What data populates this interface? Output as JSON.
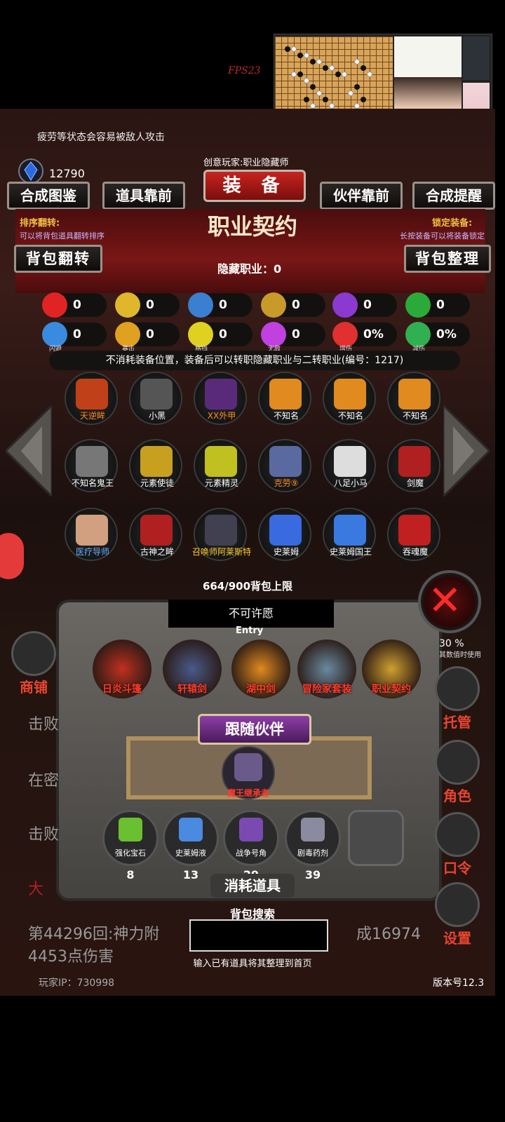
{
  "overlay": {
    "fps": "FPS23"
  },
  "hud": {
    "hint": "疲劳等状态会容易被敌人攻击",
    "currency": "12790"
  },
  "header": {
    "subtitle": "创意玩家:职业隐藏师",
    "title": "装 备",
    "tabs": [
      "合成图鉴",
      "道具靠前",
      "伙伴靠前",
      "合成提醒"
    ]
  },
  "contract": {
    "title": "职业契约",
    "left_note": {
      "title": "排序翻转:",
      "sub": "可以将背包道具翻转排序"
    },
    "right_note": {
      "title": "锁定装备:",
      "sub": "长按装备可以将装备锁定"
    },
    "left_button": "背包翻转",
    "right_button": "背包整理",
    "hidden_jobs": "隐藏职业：0"
  },
  "stats": [
    {
      "icon": "heart-icon",
      "value": "0",
      "label": "",
      "color": "#e02424"
    },
    {
      "icon": "armor-icon",
      "value": "0",
      "label": "",
      "color": "#e0b62a"
    },
    {
      "icon": "boot-icon",
      "value": "0",
      "label": "",
      "color": "#3a7fd0"
    },
    {
      "icon": "sword-icon",
      "value": "0",
      "label": "",
      "color": "#c89a2a"
    },
    {
      "icon": "lightning-icon",
      "value": "0",
      "label": "",
      "color": "#8a3ad0"
    },
    {
      "icon": "clover-icon",
      "value": "0",
      "label": "",
      "color": "#2aaa3a"
    },
    {
      "icon": "dodge-icon",
      "value": "0",
      "label": "闪避",
      "color": "#3a8ae0"
    },
    {
      "icon": "crit-icon",
      "value": "0",
      "label": "暴击",
      "color": "#e0a020"
    },
    {
      "icon": "block-icon",
      "value": "0",
      "label": "格挡",
      "color": "#e0d020"
    },
    {
      "icon": "invincible-icon",
      "value": "0",
      "label": "无敌",
      "color": "#c040e0"
    },
    {
      "icon": "damage-up-icon",
      "value": "0%",
      "label": "增伤",
      "color": "#e03030"
    },
    {
      "icon": "damage-down-icon",
      "value": "0%",
      "label": "减伤",
      "color": "#30b050"
    }
  ],
  "description": "不消耗装备位置，装备后可以转职隐藏职业与二转职业(编号：1217)",
  "jobs": [
    {
      "name": "天逆眸",
      "color": "#ff8a1a",
      "pic": "#c0401a"
    },
    {
      "name": "小黑",
      "color": "#ffffff",
      "pic": "#555"
    },
    {
      "name": "XX外甲",
      "color": "#ff8a1a",
      "pic": "#5a2a7a"
    },
    {
      "name": "不知名",
      "color": "#ffffff",
      "pic": "#e08a20"
    },
    {
      "name": "不知名",
      "color": "#ffffff",
      "pic": "#e08a20"
    },
    {
      "name": "不知名",
      "color": "#ffffff",
      "pic": "#e08a20"
    },
    {
      "name": "不知名鬼王",
      "color": "#ffffff",
      "pic": "#777"
    },
    {
      "name": "元素使徒",
      "color": "#ffffff",
      "pic": "#c8a020"
    },
    {
      "name": "元素精灵",
      "color": "#ffffff",
      "pic": "#c0c020"
    },
    {
      "name": "克劳⑨",
      "color": "#ff8a1a",
      "pic": "#5a6aa0"
    },
    {
      "name": "八足小马",
      "color": "#ffffff",
      "pic": "#ddd"
    },
    {
      "name": "剑魔",
      "color": "#ffffff",
      "pic": "#b02020"
    },
    {
      "name": "医疗导师",
      "color": "#6ab0ff",
      "pic": "#d0a080"
    },
    {
      "name": "古神之眸",
      "color": "#ffffff",
      "pic": "#b02020"
    },
    {
      "name": "召唤师阿莱斯特",
      "color": "#ffcc30",
      "pic": "#404050"
    },
    {
      "name": "史莱姆",
      "color": "#ffffff",
      "pic": "#3a6ae0"
    },
    {
      "name": "史莱姆国王",
      "color": "#ffffff",
      "pic": "#3a7ae0"
    },
    {
      "name": "吞魂魔",
      "color": "#ffffff",
      "pic": "#c02020"
    }
  ],
  "bag_limit": "664/900背包上限",
  "wish": {
    "label": "不可许愿",
    "entry": "Entry"
  },
  "equipped": [
    {
      "name": "日炎斗篷",
      "pic": "#c03020"
    },
    {
      "name": "轩辕剑",
      "pic": "#4a5a8a"
    },
    {
      "name": "湖中剑",
      "pic": "#e08a20"
    },
    {
      "name": "冒险家套装",
      "pic": "#6a8aa0"
    },
    {
      "name": "职业契约",
      "pic": "#d0a030"
    }
  ],
  "follow": {
    "title": "跟随伙伴",
    "pet": "魔王继承者"
  },
  "items": [
    {
      "name": "强化宝石",
      "count": "8",
      "pic": "#6ac030"
    },
    {
      "name": "史莱姆液",
      "count": "13",
      "pic": "#4a8ae0"
    },
    {
      "name": "战争号角",
      "count": "29",
      "pic": "#7a4ab0"
    },
    {
      "name": "剧毒药剂",
      "count": "39",
      "pic": "#8a8aa0"
    }
  ],
  "consumable_title": "消耗道具",
  "search": {
    "title": "背包搜索",
    "hint": "输入已有道具将其整理到首页",
    "value": ""
  },
  "log": {
    "line1": "击败",
    "line2": "在密",
    "line3": "击败",
    "line4": "大",
    "line5": "第44296回:神力附",
    "line5b": "成16974",
    "line6": "4453点伤害"
  },
  "right_menu": [
    {
      "label": "商铺",
      "icon": "shop-icon"
    },
    {
      "label": "托管",
      "icon": "dice-icon"
    },
    {
      "label": "角色",
      "icon": "character-icon"
    },
    {
      "label": "口令",
      "icon": "book-icon"
    },
    {
      "label": "设置",
      "icon": "gear-icon"
    }
  ],
  "misc": {
    "value_note": "其数值时使用",
    "pct": "30 %"
  },
  "footer": {
    "ip": "玩家IP：730998",
    "version": "版本号12.3"
  }
}
